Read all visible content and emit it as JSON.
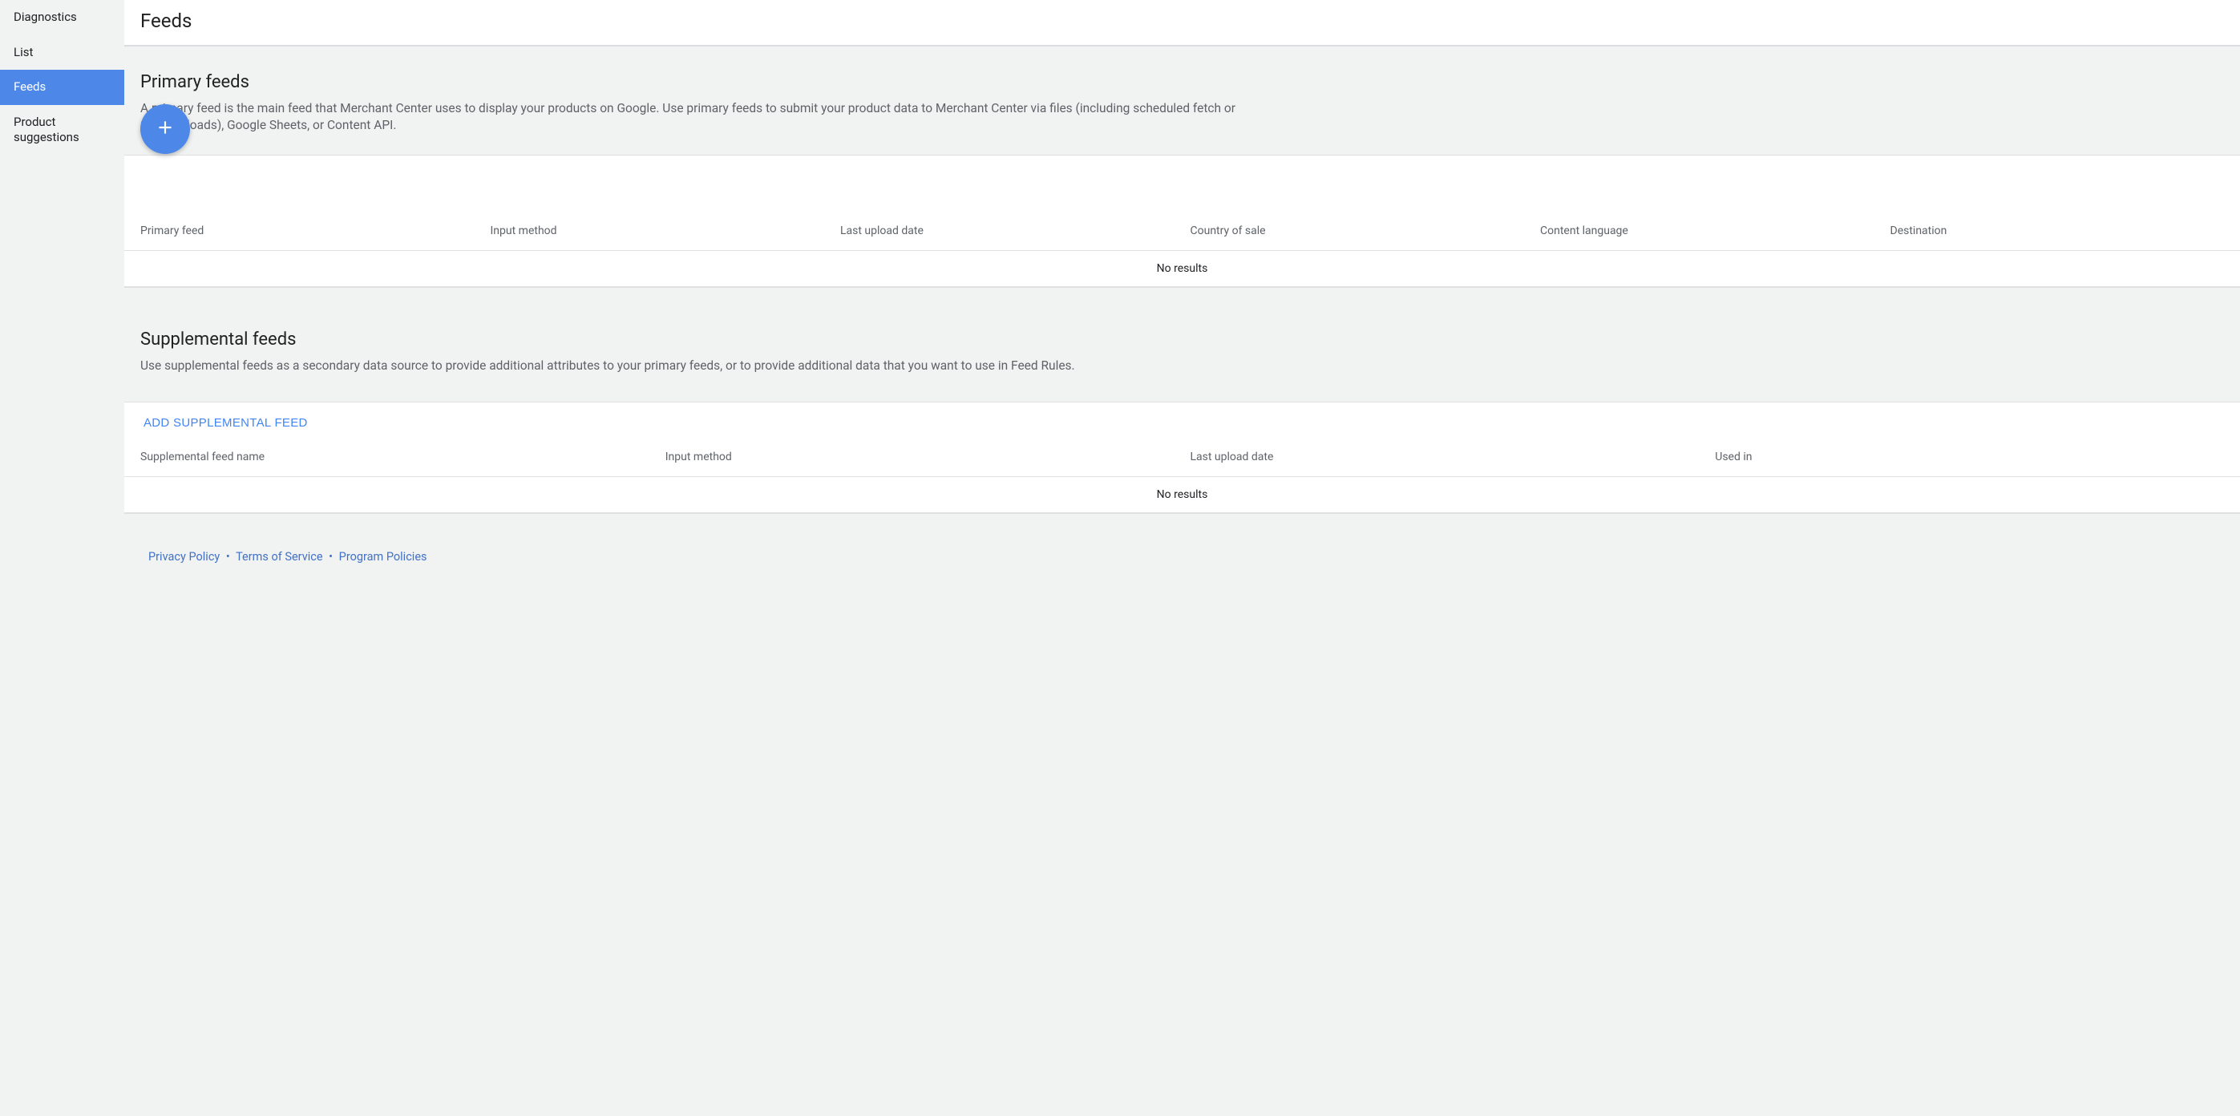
{
  "sidebar": {
    "items": [
      {
        "label": "Diagnostics"
      },
      {
        "label": "List"
      },
      {
        "label": "Feeds"
      },
      {
        "label": "Product suggestions"
      }
    ]
  },
  "header": {
    "title": "Feeds"
  },
  "primary": {
    "title": "Primary feeds",
    "desc": "A primary feed is the main feed that Merchant Center uses to display your products on Google. Use primary feeds to submit your product data to Merchant Center via files (including scheduled fetch or SFTP uploads), Google Sheets, or Content API.",
    "columns": [
      "Primary feed",
      "Input method",
      "Last upload date",
      "Country of sale",
      "Content language",
      "Destination"
    ],
    "no_results": "No results"
  },
  "supplemental": {
    "title": "Supplemental feeds",
    "desc": "Use supplemental feeds as a secondary data source to provide additional attributes to your primary feeds, or to provide additional data that you want to use in Feed Rules.",
    "add_label": "ADD SUPPLEMENTAL FEED",
    "columns": [
      "Supplemental feed name",
      "Input method",
      "Last upload date",
      "Used in"
    ],
    "no_results": "No results"
  },
  "footer": {
    "privacy": "Privacy Policy",
    "terms": "Terms of Service",
    "program": "Program Policies"
  }
}
